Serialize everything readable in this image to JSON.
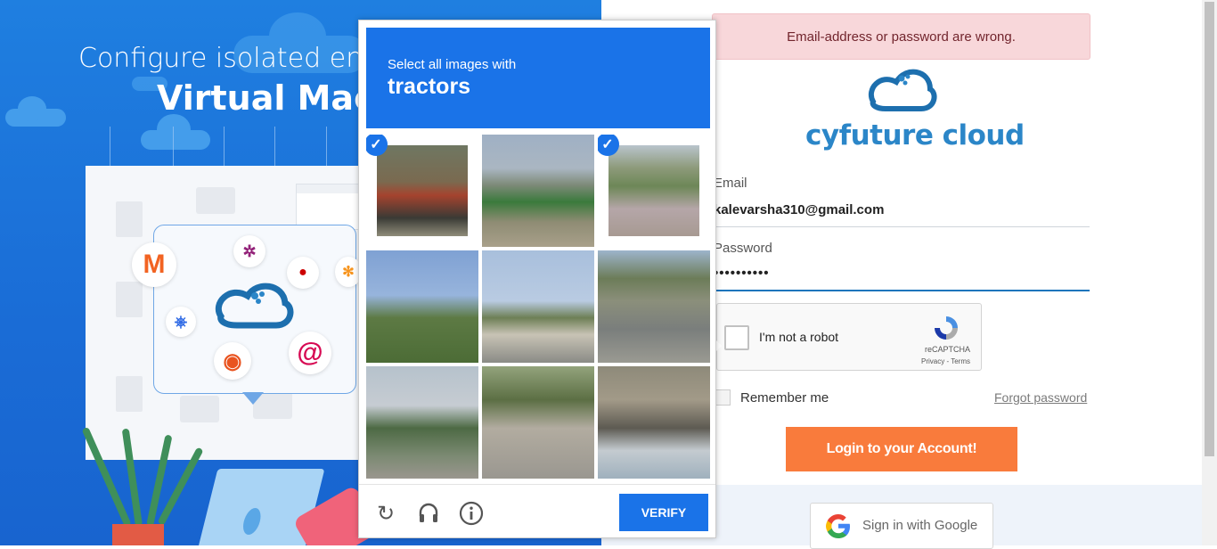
{
  "promo": {
    "line1": "Configure isolated envi",
    "line2": "Virtual Mach"
  },
  "alert": {
    "message": "Email-address or password are wrong."
  },
  "brand": {
    "name": "cyfuture cloud"
  },
  "form": {
    "email_label": "Email",
    "email_value": "kalevarsha310@gmail.com",
    "password_label": "Password",
    "password_value": "••••••••••",
    "remember_label": "Remember me",
    "forgot_label": "Forgot password",
    "login_label": "Login to your Account!",
    "google_label": "Sign in with Google"
  },
  "recaptcha": {
    "checkbox_label": "I'm not a robot",
    "brand": "reCAPTCHA",
    "links": "Privacy - Terms"
  },
  "challenge": {
    "instruction": "Select all images with",
    "target": "tractors",
    "verify_label": "VERIFY",
    "tiles": [
      {
        "desc": "tractor",
        "selected": true
      },
      {
        "desc": "tractors-field",
        "selected": false
      },
      {
        "desc": "tractor-field",
        "selected": true
      },
      {
        "desc": "palm-tree",
        "selected": false
      },
      {
        "desc": "street-palms",
        "selected": false
      },
      {
        "desc": "road-cars",
        "selected": false
      },
      {
        "desc": "hillside-trees",
        "selected": false
      },
      {
        "desc": "cyclist-street",
        "selected": false
      },
      {
        "desc": "car-wall",
        "selected": false
      }
    ]
  },
  "colors": {
    "accent": "#1a73e8",
    "login": "#f97b3c",
    "alert_bg": "#f8d7da",
    "brand": "#2b86c8"
  }
}
